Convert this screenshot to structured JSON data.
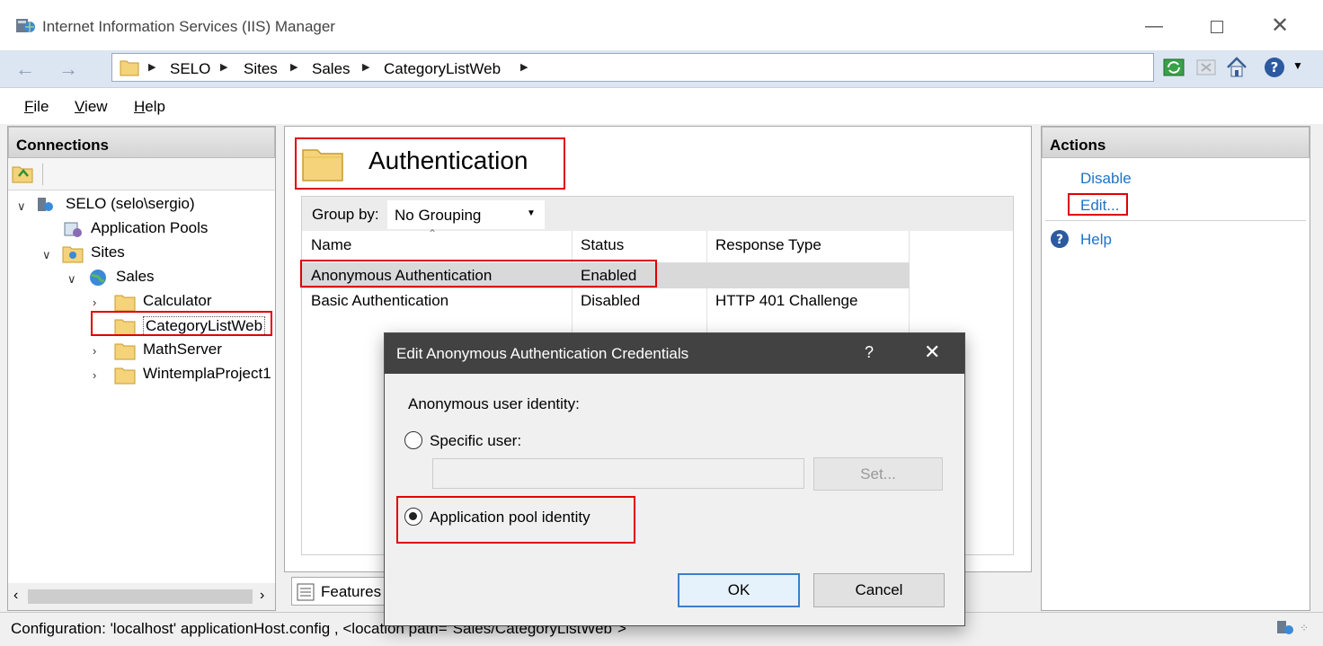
{
  "window": {
    "title": "Internet Information Services (IIS) Manager"
  },
  "address": {
    "crumbs": [
      "SELO",
      "Sites",
      "Sales",
      "CategoryListWeb"
    ]
  },
  "menu": {
    "file": "File",
    "file_u": "F",
    "file_rest": "ile",
    "view_u": "V",
    "view_rest": "iew",
    "help_u": "H",
    "help_rest": "elp"
  },
  "connections": {
    "header": "Connections",
    "tree": {
      "server": "SELO (selo\\sergio)",
      "app_pools": "Application Pools",
      "sites": "Sites",
      "site_sales": "Sales",
      "apps": [
        "Calculator",
        "CategoryListWeb",
        "MathServer",
        "WintemplaProject1"
      ]
    }
  },
  "feature": {
    "title": "Authentication",
    "group_by_label": "Group by:",
    "group_by_value": "No Grouping",
    "columns": {
      "name": "Name",
      "status": "Status",
      "response": "Response Type"
    },
    "rows": [
      {
        "name": "Anonymous Authentication",
        "status": "Enabled",
        "response": ""
      },
      {
        "name": "Basic Authentication",
        "status": "Disabled",
        "response": "HTTP 401 Challenge"
      }
    ],
    "tab_features": "Features"
  },
  "actions": {
    "header": "Actions",
    "disable": "Disable",
    "edit": "Edit...",
    "help": "Help"
  },
  "status": {
    "text": "Configuration: 'localhost' applicationHost.config , <location path=\"Sales/CategoryListWeb\">"
  },
  "dialog": {
    "title": "Edit Anonymous Authentication Credentials",
    "help_glyph": "?",
    "identity_label": "Anonymous user identity:",
    "specific_user": "Specific user:",
    "specific_user_value": "",
    "set_button": "Set...",
    "app_pool_identity": "Application pool identity",
    "selected": "app_pool",
    "ok": "OK",
    "cancel": "Cancel"
  },
  "colors": {
    "highlight": "#e00000",
    "link": "#1e73c8",
    "dialog_title_bg": "#424242"
  }
}
